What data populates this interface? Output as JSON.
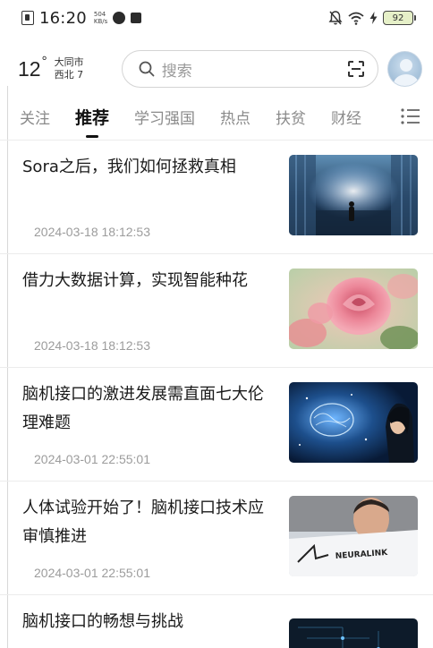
{
  "status_bar": {
    "time": "16:20",
    "net_speed_value": "504",
    "net_speed_unit": "KB/s",
    "battery": "92"
  },
  "header": {
    "temperature": "12",
    "degree_symbol": "°",
    "city": "大同市",
    "wind": "西北 7",
    "search_placeholder": "搜索"
  },
  "tabs": [
    {
      "label": "关注",
      "active": false
    },
    {
      "label": "推荐",
      "active": true
    },
    {
      "label": "学习强国",
      "active": false
    },
    {
      "label": "热点",
      "active": false
    },
    {
      "label": "扶贫",
      "active": false
    },
    {
      "label": "财经",
      "active": false
    }
  ],
  "news": [
    {
      "title": "Sora之后，我们如何拯救真相",
      "date": "2024-03-18 18:12:53",
      "image": "person-in-digital-corridor"
    },
    {
      "title": "借力大数据计算，实现智能种花",
      "date": "2024-03-18 18:12:53",
      "image": "pink-roses"
    },
    {
      "title": "脑机接口的激进发展需直面七大伦理难题",
      "date": "2024-03-01 22:55:01",
      "image": "digital-brain-and-woman"
    },
    {
      "title": "人体试验开始了！脑机接口技术应审慎推进",
      "date": "2024-03-01 22:55:01",
      "image": "man-and-neuralink-logo",
      "image_text": "NEURALINK"
    },
    {
      "title": "脑机接口的畅想与挑战",
      "date": "",
      "image": "dark-tech-circuit"
    }
  ],
  "colors": {
    "accent": "#111111",
    "muted_text": "#9c9c9c",
    "tab_inactive": "#8a8a8a",
    "divider": "#ececec"
  }
}
